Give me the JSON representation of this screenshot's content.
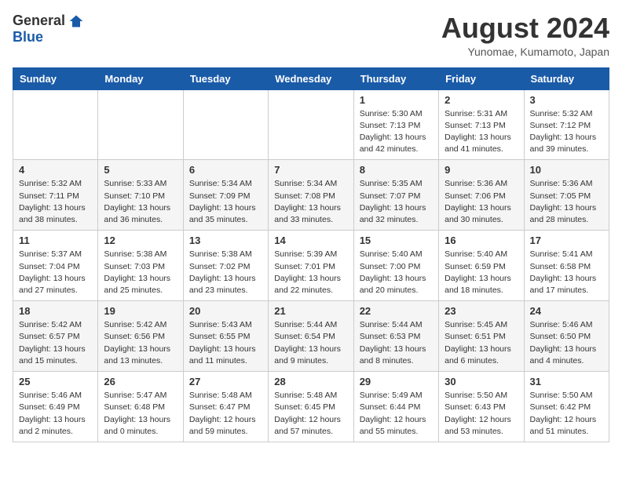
{
  "logo": {
    "general": "General",
    "blue": "Blue"
  },
  "title": {
    "month_year": "August 2024",
    "location": "Yunomae, Kumamoto, Japan"
  },
  "headers": [
    "Sunday",
    "Monday",
    "Tuesday",
    "Wednesday",
    "Thursday",
    "Friday",
    "Saturday"
  ],
  "weeks": [
    [
      {
        "day": "",
        "info": ""
      },
      {
        "day": "",
        "info": ""
      },
      {
        "day": "",
        "info": ""
      },
      {
        "day": "",
        "info": ""
      },
      {
        "day": "1",
        "info": "Sunrise: 5:30 AM\nSunset: 7:13 PM\nDaylight: 13 hours\nand 42 minutes."
      },
      {
        "day": "2",
        "info": "Sunrise: 5:31 AM\nSunset: 7:13 PM\nDaylight: 13 hours\nand 41 minutes."
      },
      {
        "day": "3",
        "info": "Sunrise: 5:32 AM\nSunset: 7:12 PM\nDaylight: 13 hours\nand 39 minutes."
      }
    ],
    [
      {
        "day": "4",
        "info": "Sunrise: 5:32 AM\nSunset: 7:11 PM\nDaylight: 13 hours\nand 38 minutes."
      },
      {
        "day": "5",
        "info": "Sunrise: 5:33 AM\nSunset: 7:10 PM\nDaylight: 13 hours\nand 36 minutes."
      },
      {
        "day": "6",
        "info": "Sunrise: 5:34 AM\nSunset: 7:09 PM\nDaylight: 13 hours\nand 35 minutes."
      },
      {
        "day": "7",
        "info": "Sunrise: 5:34 AM\nSunset: 7:08 PM\nDaylight: 13 hours\nand 33 minutes."
      },
      {
        "day": "8",
        "info": "Sunrise: 5:35 AM\nSunset: 7:07 PM\nDaylight: 13 hours\nand 32 minutes."
      },
      {
        "day": "9",
        "info": "Sunrise: 5:36 AM\nSunset: 7:06 PM\nDaylight: 13 hours\nand 30 minutes."
      },
      {
        "day": "10",
        "info": "Sunrise: 5:36 AM\nSunset: 7:05 PM\nDaylight: 13 hours\nand 28 minutes."
      }
    ],
    [
      {
        "day": "11",
        "info": "Sunrise: 5:37 AM\nSunset: 7:04 PM\nDaylight: 13 hours\nand 27 minutes."
      },
      {
        "day": "12",
        "info": "Sunrise: 5:38 AM\nSunset: 7:03 PM\nDaylight: 13 hours\nand 25 minutes."
      },
      {
        "day": "13",
        "info": "Sunrise: 5:38 AM\nSunset: 7:02 PM\nDaylight: 13 hours\nand 23 minutes."
      },
      {
        "day": "14",
        "info": "Sunrise: 5:39 AM\nSunset: 7:01 PM\nDaylight: 13 hours\nand 22 minutes."
      },
      {
        "day": "15",
        "info": "Sunrise: 5:40 AM\nSunset: 7:00 PM\nDaylight: 13 hours\nand 20 minutes."
      },
      {
        "day": "16",
        "info": "Sunrise: 5:40 AM\nSunset: 6:59 PM\nDaylight: 13 hours\nand 18 minutes."
      },
      {
        "day": "17",
        "info": "Sunrise: 5:41 AM\nSunset: 6:58 PM\nDaylight: 13 hours\nand 17 minutes."
      }
    ],
    [
      {
        "day": "18",
        "info": "Sunrise: 5:42 AM\nSunset: 6:57 PM\nDaylight: 13 hours\nand 15 minutes."
      },
      {
        "day": "19",
        "info": "Sunrise: 5:42 AM\nSunset: 6:56 PM\nDaylight: 13 hours\nand 13 minutes."
      },
      {
        "day": "20",
        "info": "Sunrise: 5:43 AM\nSunset: 6:55 PM\nDaylight: 13 hours\nand 11 minutes."
      },
      {
        "day": "21",
        "info": "Sunrise: 5:44 AM\nSunset: 6:54 PM\nDaylight: 13 hours\nand 9 minutes."
      },
      {
        "day": "22",
        "info": "Sunrise: 5:44 AM\nSunset: 6:53 PM\nDaylight: 13 hours\nand 8 minutes."
      },
      {
        "day": "23",
        "info": "Sunrise: 5:45 AM\nSunset: 6:51 PM\nDaylight: 13 hours\nand 6 minutes."
      },
      {
        "day": "24",
        "info": "Sunrise: 5:46 AM\nSunset: 6:50 PM\nDaylight: 13 hours\nand 4 minutes."
      }
    ],
    [
      {
        "day": "25",
        "info": "Sunrise: 5:46 AM\nSunset: 6:49 PM\nDaylight: 13 hours\nand 2 minutes."
      },
      {
        "day": "26",
        "info": "Sunrise: 5:47 AM\nSunset: 6:48 PM\nDaylight: 13 hours\nand 0 minutes."
      },
      {
        "day": "27",
        "info": "Sunrise: 5:48 AM\nSunset: 6:47 PM\nDaylight: 12 hours\nand 59 minutes."
      },
      {
        "day": "28",
        "info": "Sunrise: 5:48 AM\nSunset: 6:45 PM\nDaylight: 12 hours\nand 57 minutes."
      },
      {
        "day": "29",
        "info": "Sunrise: 5:49 AM\nSunset: 6:44 PM\nDaylight: 12 hours\nand 55 minutes."
      },
      {
        "day": "30",
        "info": "Sunrise: 5:50 AM\nSunset: 6:43 PM\nDaylight: 12 hours\nand 53 minutes."
      },
      {
        "day": "31",
        "info": "Sunrise: 5:50 AM\nSunset: 6:42 PM\nDaylight: 12 hours\nand 51 minutes."
      }
    ]
  ]
}
